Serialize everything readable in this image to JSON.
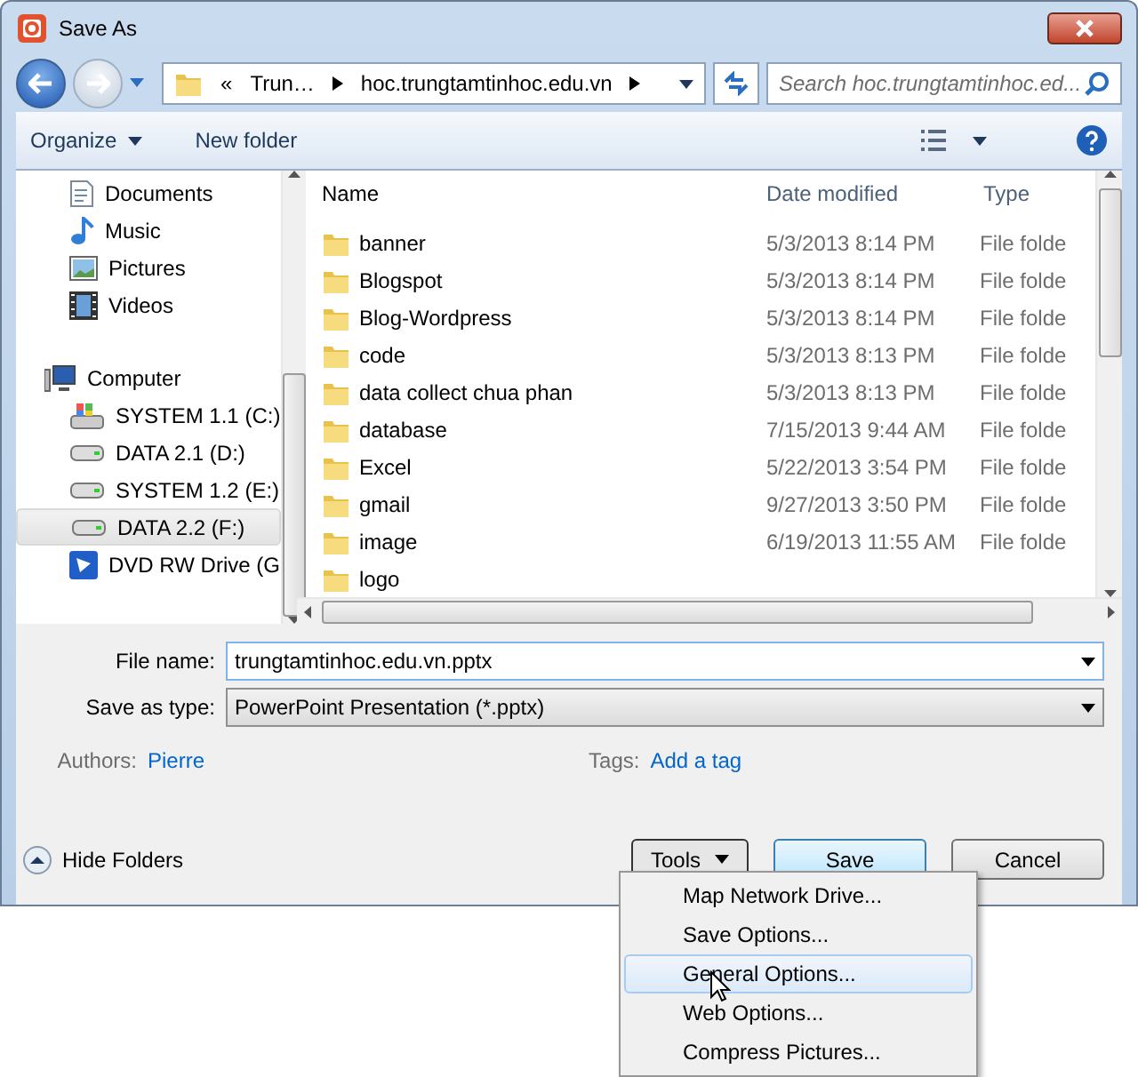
{
  "window": {
    "title": "Save As"
  },
  "navigation": {
    "back_enabled": true,
    "forward_enabled": false
  },
  "address": {
    "segments": [
      "«",
      "Trun…",
      "hoc.trungtamtinhoc.edu.vn"
    ]
  },
  "search": {
    "placeholder": "Search hoc.trungtamtinhoc.ed..."
  },
  "toolbar": [
    "Organize",
    "New folder"
  ],
  "sidebar": {
    "items": [
      {
        "label": "Documents",
        "kind": "documents",
        "selected": false
      },
      {
        "label": "Music",
        "kind": "music",
        "selected": false
      },
      {
        "label": "Pictures",
        "kind": "pictures",
        "selected": false
      },
      {
        "label": "Videos",
        "kind": "videos",
        "selected": false
      },
      {
        "label": "Computer",
        "kind": "computer",
        "selected": false,
        "children": [
          {
            "label": "SYSTEM 1.1 (C:)",
            "kind": "system",
            "selected": false
          },
          {
            "label": "DATA 2.1 (D:)",
            "kind": "drive",
            "selected": false
          },
          {
            "label": "SYSTEM 1.2 (E:)",
            "kind": "drive",
            "selected": false
          },
          {
            "label": "DATA 2.2 (F:)",
            "kind": "drive",
            "selected": true
          },
          {
            "label": "DVD RW Drive (G",
            "kind": "dvd",
            "selected": false
          }
        ]
      }
    ]
  },
  "table": {
    "columns": [
      "Name",
      "Date modified",
      "Type"
    ],
    "rows": [
      {
        "name": "banner",
        "date": "5/3/2013 8:14 PM",
        "type": "File folde"
      },
      {
        "name": "Blogspot",
        "date": "5/3/2013 8:14 PM",
        "type": "File folde"
      },
      {
        "name": "Blog-Wordpress",
        "date": "5/3/2013 8:14 PM",
        "type": "File folde"
      },
      {
        "name": "code",
        "date": "5/3/2013 8:13 PM",
        "type": "File folde"
      },
      {
        "name": "data collect chua phan",
        "date": "5/3/2013 8:13 PM",
        "type": "File folde"
      },
      {
        "name": "database",
        "date": "7/15/2013 9:44 AM",
        "type": "File folde"
      },
      {
        "name": "Excel",
        "date": "5/22/2013 3:54 PM",
        "type": "File folde"
      },
      {
        "name": "gmail",
        "date": "9/27/2013 3:50 PM",
        "type": "File folde"
      },
      {
        "name": "image",
        "date": "6/19/2013 11:55 AM",
        "type": "File folde"
      },
      {
        "name": "logo"
      }
    ]
  },
  "form": {
    "file_name_label": "File name:",
    "file_name": "trungtamtinhoc.edu.vn.pptx",
    "type_label": "Save as type:",
    "type_value": "PowerPoint Presentation (*.pptx)",
    "authors_label": "Authors:",
    "authors": "Pierre",
    "tags_label": "Tags:",
    "tags": "Add a tag"
  },
  "hide_folders": "Hide Folders",
  "buttons": [
    "Tools",
    "Save",
    "Cancel"
  ],
  "tools_menu": [
    {
      "label": "Map Network Drive...",
      "selected": false
    },
    {
      "label": "Save Options...",
      "selected": false
    },
    {
      "label": "General Options...",
      "selected": true
    },
    {
      "label": "Web Options...",
      "selected": false
    },
    {
      "label": "Compress Pictures...",
      "selected": false
    }
  ]
}
